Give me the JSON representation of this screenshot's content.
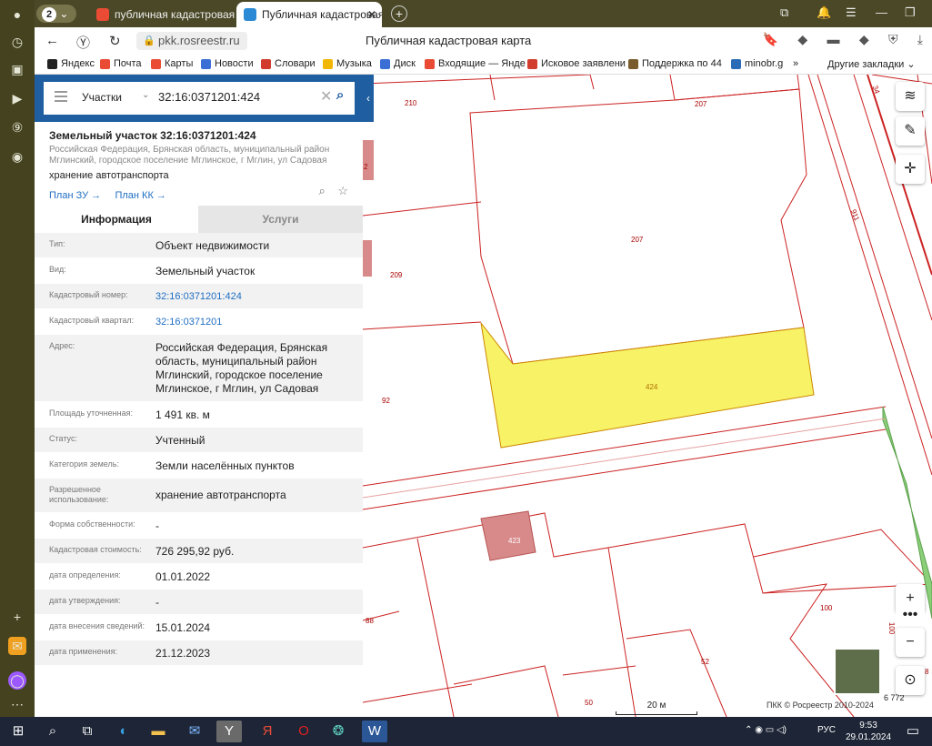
{
  "browser": {
    "tab_count": "2",
    "tabs": [
      {
        "title": "публичная кадастровая к",
        "active": false
      },
      {
        "title": "Публичная кадастровая",
        "active": true
      }
    ],
    "url": "pkk.rosreestr.ru",
    "page_title": "Публичная кадастровая карта"
  },
  "bookmarks": [
    {
      "label": "Яндекс",
      "color": "#222222"
    },
    {
      "label": "Почта",
      "color": "#e94b35"
    },
    {
      "label": "Карты",
      "color": "#e94b35"
    },
    {
      "label": "Новости",
      "color": "#3b6fd6"
    },
    {
      "label": "Словари",
      "color": "#d23c2c"
    },
    {
      "label": "Музыка",
      "color": "#f2b705"
    },
    {
      "label": "Диск",
      "color": "#3b6fd6"
    },
    {
      "label": "Входящие — Янде",
      "color": "#e94b35"
    },
    {
      "label": "Исковое заявлени",
      "color": "#d23c2c"
    },
    {
      "label": "Поддержка по 44",
      "color": "#7a5b2c"
    },
    {
      "label": "minobr.g",
      "color": "#2a6bb8"
    },
    {
      "label": "Другие закладки",
      "color": "#ffffff"
    }
  ],
  "search": {
    "type": "Участки",
    "query": "32:16:0371201:424"
  },
  "parcel": {
    "title": "Земельный участок 32:16:0371201:424",
    "address_short": "Российская Федерация, Брянская область, муниципальный район Мглинский, городское поселение Мглинское, г Мглин, ул Садовая",
    "use": "хранение автотранспорта",
    "links": [
      "План ЗУ →",
      "План КК →"
    ]
  },
  "tabs": {
    "info": "Информация",
    "services": "Услуги"
  },
  "rows": [
    {
      "key": "Тип:",
      "value": "Объект недвижимости",
      "link": false
    },
    {
      "key": "Вид:",
      "value": "Земельный участок",
      "link": false
    },
    {
      "key": "Кадастровый номер:",
      "value": "32:16:0371201:424",
      "link": true
    },
    {
      "key": "Кадастровый квартал:",
      "value": "32:16:0371201",
      "link": true
    },
    {
      "key": "Адрес:",
      "value": "Российская Федерация, Брянская область, муниципальный район Мглинский, городское поселение Мглинское, г Мглин, ул Садовая",
      "link": false
    },
    {
      "key": "Площадь уточненная:",
      "value": "1 491 кв. м",
      "link": false
    },
    {
      "key": "Статус:",
      "value": "Учтенный",
      "link": false
    },
    {
      "key": "Категория земель:",
      "value": "Земли населённых пунктов",
      "link": false
    },
    {
      "key": "Разрешенное использование:",
      "value": "хранение автотранспорта",
      "link": false
    },
    {
      "key": "Форма собственности:",
      "value": "-",
      "link": false
    },
    {
      "key": "Кадастровая стоимость:",
      "value": "726 295,92 руб.",
      "link": false
    },
    {
      "key": "дата определения:",
      "value": "01.01.2022",
      "link": false
    },
    {
      "key": "дата утверждения:",
      "value": "-",
      "link": false
    },
    {
      "key": "дата внесения сведений:",
      "value": "15.01.2024",
      "link": false
    },
    {
      "key": "дата применения:",
      "value": "21.12.2023",
      "link": false
    }
  ],
  "map": {
    "labels": [
      "210",
      "207",
      "207",
      "209",
      "92",
      "424",
      "423",
      "88",
      "100",
      "52",
      "50",
      "911",
      "34",
      "2",
      "100",
      "8",
      "6 772"
    ],
    "scale_label": "20 м",
    "copyright": "ПКК © Росреестр 2010-2024",
    "colors": {
      "selected_fill": "#f7f266",
      "building_fill": "#d88a8a",
      "boundary": "#cc2222",
      "green": "#8ccf7a"
    }
  },
  "taskbar": {
    "lang": "РУС",
    "time": "9:53",
    "date": "29.01.2024"
  }
}
